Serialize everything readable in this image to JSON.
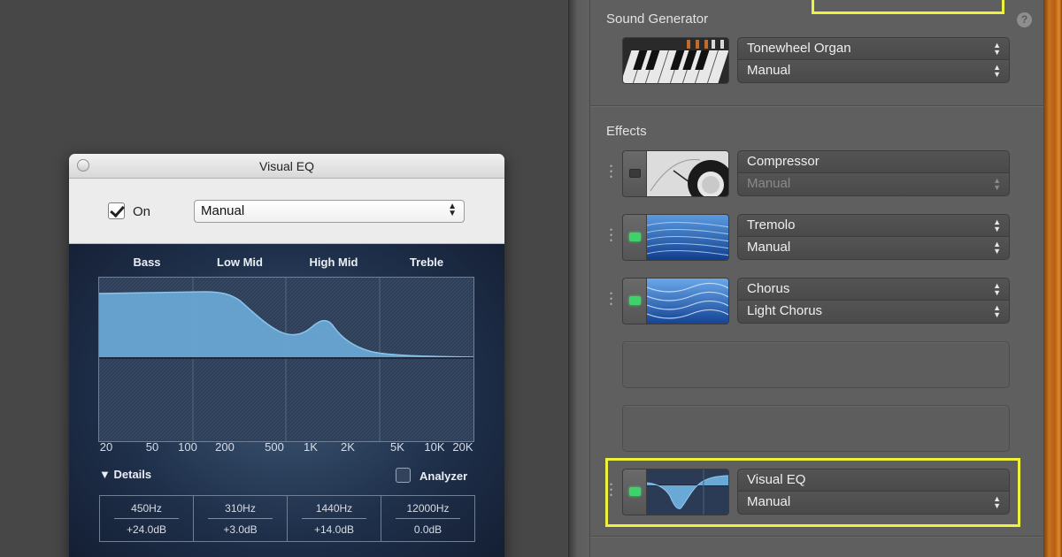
{
  "visual_eq_window": {
    "title": "Visual EQ",
    "on_label": "On",
    "on_checked": true,
    "preset": "Manual",
    "bands": [
      "Bass",
      "Low Mid",
      "High Mid",
      "Treble"
    ],
    "freq_axis": [
      "20",
      "50",
      "100",
      "200",
      "500",
      "1K",
      "2K",
      "5K",
      "10K",
      "20K"
    ],
    "details_label": "Details",
    "analyzer_label": "Analyzer",
    "analyzer_checked": false,
    "band_values": [
      {
        "hz": "450Hz",
        "db": "+24.0dB"
      },
      {
        "hz": "310Hz",
        "db": "+3.0dB"
      },
      {
        "hz": "1440Hz",
        "db": "+14.0dB"
      },
      {
        "hz": "12000Hz",
        "db": "0.0dB"
      }
    ],
    "curve_color": "#6aa9d6"
  },
  "inspector": {
    "sound_generator": {
      "title": "Sound Generator",
      "instrument": "Tonewheel Organ",
      "preset": "Manual",
      "thumb_icon": "organ-keyboard-icon"
    },
    "effects": {
      "title": "Effects",
      "slots": [
        {
          "name": "Compressor",
          "preset": "Manual",
          "preset_dim": true,
          "power": false,
          "thumb_icon": "compressor-knob-icon"
        },
        {
          "name": "Tremolo",
          "preset": "Manual",
          "power": true,
          "thumb_icon": "tremolo-wave-icon"
        },
        {
          "name": "Chorus",
          "preset": "Light Chorus",
          "power": true,
          "thumb_icon": "chorus-wave-icon"
        },
        {
          "name": "Visual EQ",
          "preset": "Manual",
          "power": true,
          "thumb_icon": "eq-curve-icon"
        }
      ]
    },
    "help_glyph": "?",
    "highlight_color": "#eef23a",
    "power_on_color": "#3dd26a"
  }
}
